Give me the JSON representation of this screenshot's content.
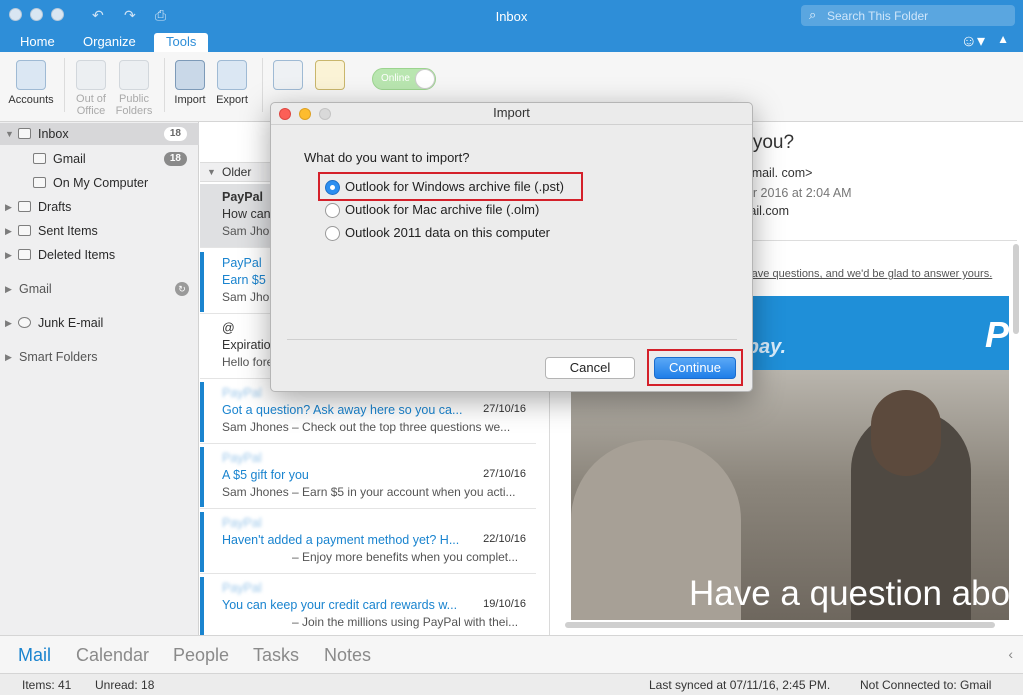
{
  "window": {
    "title": "Inbox",
    "search_placeholder": "Search This Folder"
  },
  "tabs": [
    {
      "label": "Home"
    },
    {
      "label": "Organize"
    },
    {
      "label": "Tools",
      "active": true
    }
  ],
  "ribbon": {
    "accounts": "Accounts",
    "out_of_office_1": "Out of",
    "out_of_office_2": "Office",
    "public_folders_1": "Public",
    "public_folders_2": "Folders",
    "import": "Import",
    "export": "Export",
    "online_toggle": "Online"
  },
  "folders": [
    {
      "label": "Inbox",
      "count": "18"
    },
    {
      "label": "Gmail",
      "count": "18"
    },
    {
      "label": "On My Computer"
    },
    {
      "label": "Drafts"
    },
    {
      "label": "Sent Items"
    },
    {
      "label": "Deleted Items"
    },
    {
      "label": "Gmail"
    },
    {
      "label": "Junk E-mail"
    },
    {
      "label": "Smart Folders"
    }
  ],
  "message_list": {
    "group_label": "Older",
    "messages": [
      {
        "from": "PayPal",
        "subject": "How can",
        "preview": "Sam Jhone"
      },
      {
        "from": "PayPal",
        "subject": "Earn $5",
        "preview": "Sam Jhon"
      },
      {
        "from": "@",
        "subject": "Expiration",
        "preview": "Hello fore"
      },
      {
        "from": "PayPal",
        "subject": "Got a question? Ask away here so you ca...",
        "date": "27/10/16",
        "preview": "Sam Jhones – Check out the top three questions we..."
      },
      {
        "from": "PayPal",
        "subject": "A $5 gift for you",
        "date": "27/10/16",
        "preview": "Sam Jhones – Earn $5 in your account when you acti..."
      },
      {
        "from": "PayPal",
        "subject": "Haven't added a payment method yet? H...",
        "date": "22/10/16",
        "preview": "– Enjoy more benefits when you complet..."
      },
      {
        "from": "PayPal",
        "subject": "You can keep your credit card rewards w...",
        "date": "19/10/16",
        "preview": "– Join the millions using PayPal with thei..."
      }
    ]
  },
  "reading_pane": {
    "title": "o you?",
    "from": "@mail.          com>",
    "date": "ber 2016 at 2:04 AM",
    "to": "mail.com",
    "link_text": "s have questions, and we'd be glad to answer yours.",
    "banner_line1": "o",
    "banner_line2": "o pay.",
    "banner_logo": "P",
    "photo_caption": "Have a question abo"
  },
  "dialog": {
    "title": "Import",
    "question": "What do you want to import?",
    "options": [
      {
        "label": "Outlook for Windows archive file (.pst)",
        "checked": true
      },
      {
        "label": "Outlook for Mac archive file (.olm)",
        "checked": false
      },
      {
        "label": "Outlook 2011 data on this computer",
        "checked": false
      }
    ],
    "cancel_label": "Cancel",
    "continue_label": "Continue"
  },
  "bottom_nav": [
    {
      "label": "Mail",
      "active": true
    },
    {
      "label": "Calendar"
    },
    {
      "label": "People"
    },
    {
      "label": "Tasks"
    },
    {
      "label": "Notes"
    }
  ],
  "status": {
    "items": "Items: 41",
    "unread": "Unread: 18",
    "last_synced": "Last synced at 07/11/16, 2:45 PM.",
    "connection": "Not Connected to: Gmail"
  },
  "colors": {
    "accent": "#2e8ed8",
    "link_blue": "#1a84cf",
    "highlight_red": "#d4202a",
    "primary_button": "#1f7ee8"
  }
}
